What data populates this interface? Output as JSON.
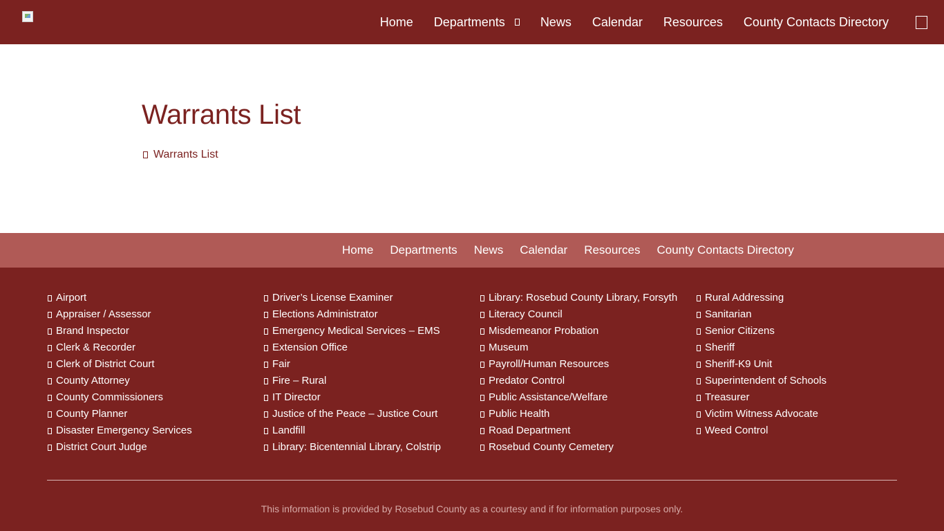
{
  "header": {
    "nav": [
      {
        "label": "Home"
      },
      {
        "label": "Departments"
      },
      {
        "label": "News"
      },
      {
        "label": "Calendar"
      },
      {
        "label": "Resources"
      },
      {
        "label": "County Contacts Directory"
      }
    ]
  },
  "main": {
    "title": "Warrants List",
    "document_link": "Warrants List"
  },
  "footer_nav": [
    {
      "label": "Home"
    },
    {
      "label": "Departments"
    },
    {
      "label": "News"
    },
    {
      "label": "Calendar"
    },
    {
      "label": "Resources"
    },
    {
      "label": "County Contacts Directory"
    }
  ],
  "departments": {
    "columns": [
      [
        "Airport",
        "Appraiser / Assessor",
        "Brand Inspector",
        "Clerk & Recorder",
        "Clerk of District Court",
        "County Attorney",
        "County Commissioners",
        "County Planner",
        "Disaster Emergency Services",
        "District Court Judge"
      ],
      [
        "Driver’s License Examiner",
        "Elections Administrator",
        "Emergency Medical Services – EMS",
        "Extension Office",
        "Fair",
        "Fire – Rural",
        "IT Director",
        "Justice of the Peace – Justice Court",
        "Landfill",
        "Library: Bicentennial Library, Colstrip"
      ],
      [
        "Library: Rosebud County Library, Forsyth",
        "Literacy Council",
        "Misdemeanor Probation",
        "Museum",
        "Payroll/Human Resources",
        "Predator Control",
        "Public Assistance/Welfare",
        "Public Health",
        "Road Department",
        "Rosebud County Cemetery"
      ],
      [
        "Rural Addressing",
        "Sanitarian",
        "Senior Citizens",
        "Sheriff",
        "Sheriff-K9 Unit",
        "Superintendent of Schools",
        "Treasurer",
        "Victim Witness Advocate",
        "Weed Control"
      ]
    ]
  },
  "disclaimer": "This information is provided by Rosebud County as a courtesy and if for information purposes only.",
  "icons": {
    "logo": "broken-image-icon",
    "nav_caret": "chevron-down-icon",
    "search": "search-icon",
    "document": "file-icon",
    "list_bullet": "chevron-right-icon"
  },
  "colors": {
    "brand": "#7b2220",
    "footer_nav_bg": "#b05a56",
    "disclaimer_text": "#d6a9a6"
  }
}
